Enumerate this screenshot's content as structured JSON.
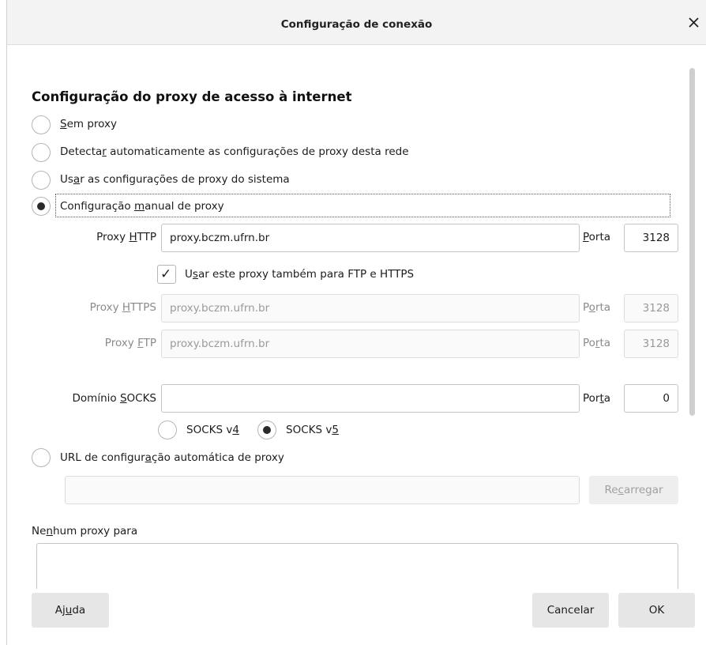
{
  "dialog": {
    "title": "Configuração de conexão"
  },
  "section": {
    "heading": "Configuração do proxy de acesso à internet"
  },
  "radios": [
    {
      "pre": "",
      "key": "S",
      "post": "em proxy",
      "checked": false
    },
    {
      "pre": "Detecta",
      "key": "r",
      "post": " automaticamente as configurações de proxy desta rede",
      "checked": false
    },
    {
      "pre": "Us",
      "key": "a",
      "post": "r as configurações de proxy do sistema",
      "checked": false
    },
    {
      "pre": "Configuração ",
      "key": "m",
      "post": "anual de proxy",
      "checked": true
    }
  ],
  "http": {
    "label_pre": "Proxy ",
    "label_key": "H",
    "label_post": "TTP",
    "value": "proxy.bczm.ufrn.br",
    "port_label_key": "P",
    "port_label_post": "orta",
    "port": "3128"
  },
  "also_use": {
    "pre": "U",
    "key": "s",
    "post": "ar este proxy também para FTP e HTTPS",
    "checked": true
  },
  "https": {
    "label_pre": "Proxy ",
    "label_key": "H",
    "label_post": "TTPS",
    "value": "proxy.bczm.ufrn.br",
    "port_label_pre": "P",
    "port_label_key": "o",
    "port_label_post": "rta",
    "port": "3128"
  },
  "ftp": {
    "label_pre": "Proxy ",
    "label_key": "F",
    "label_post": "TP",
    "value": "proxy.bczm.ufrn.br",
    "port_label_pre": "Po",
    "port_label_key": "r",
    "port_label_post": "ta",
    "port": "3128"
  },
  "socks": {
    "label_pre": "Domínio ",
    "label_key": "S",
    "label_post": "OCKS",
    "value": "",
    "port_label_pre": "Por",
    "port_label_key": "t",
    "port_label_post": "a",
    "port": "0",
    "v4_pre": "SOCKS v",
    "v4_key": "4",
    "v5_pre": "SOCKS v",
    "v5_key": "5",
    "selected": "v5"
  },
  "auto_url": {
    "pre": "URL de configur",
    "key": "a",
    "post": "ção automática de proxy",
    "value": "",
    "reload_pre": "Re",
    "reload_key": "c",
    "reload_post": "arregar"
  },
  "no_proxy": {
    "pre": "Ne",
    "key": "n",
    "post": "hum proxy para",
    "value": ""
  },
  "buttons": {
    "help_pre": "Aj",
    "help_key": "u",
    "help_post": "da",
    "cancel": "Cancelar",
    "ok": "OK"
  }
}
